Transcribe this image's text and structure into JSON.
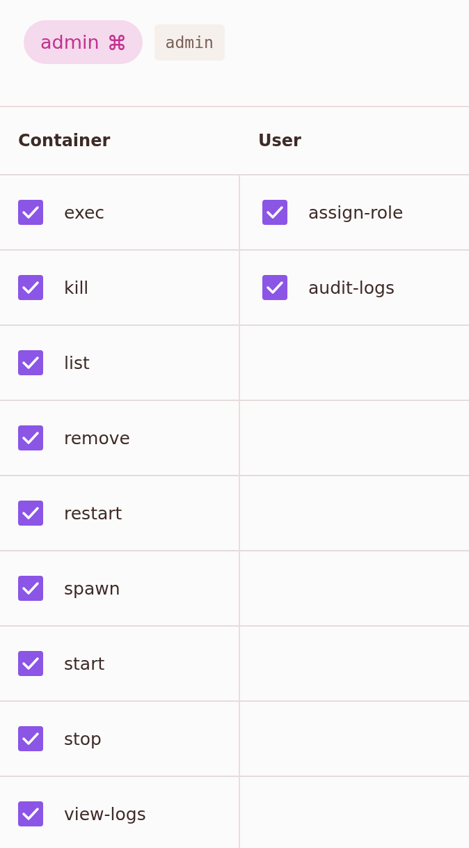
{
  "role_badge": {
    "label": "admin"
  },
  "role_code": "admin",
  "columns": [
    {
      "heading": "Container",
      "items": [
        {
          "label": "exec",
          "checked": true
        },
        {
          "label": "kill",
          "checked": true
        },
        {
          "label": "list",
          "checked": true
        },
        {
          "label": "remove",
          "checked": true
        },
        {
          "label": "restart",
          "checked": true
        },
        {
          "label": "spawn",
          "checked": true
        },
        {
          "label": "start",
          "checked": true
        },
        {
          "label": "stop",
          "checked": true
        },
        {
          "label": "view-logs",
          "checked": true
        }
      ]
    },
    {
      "heading": "User",
      "items": [
        {
          "label": "assign-role",
          "checked": true
        },
        {
          "label": "audit-logs",
          "checked": true
        }
      ]
    }
  ]
}
